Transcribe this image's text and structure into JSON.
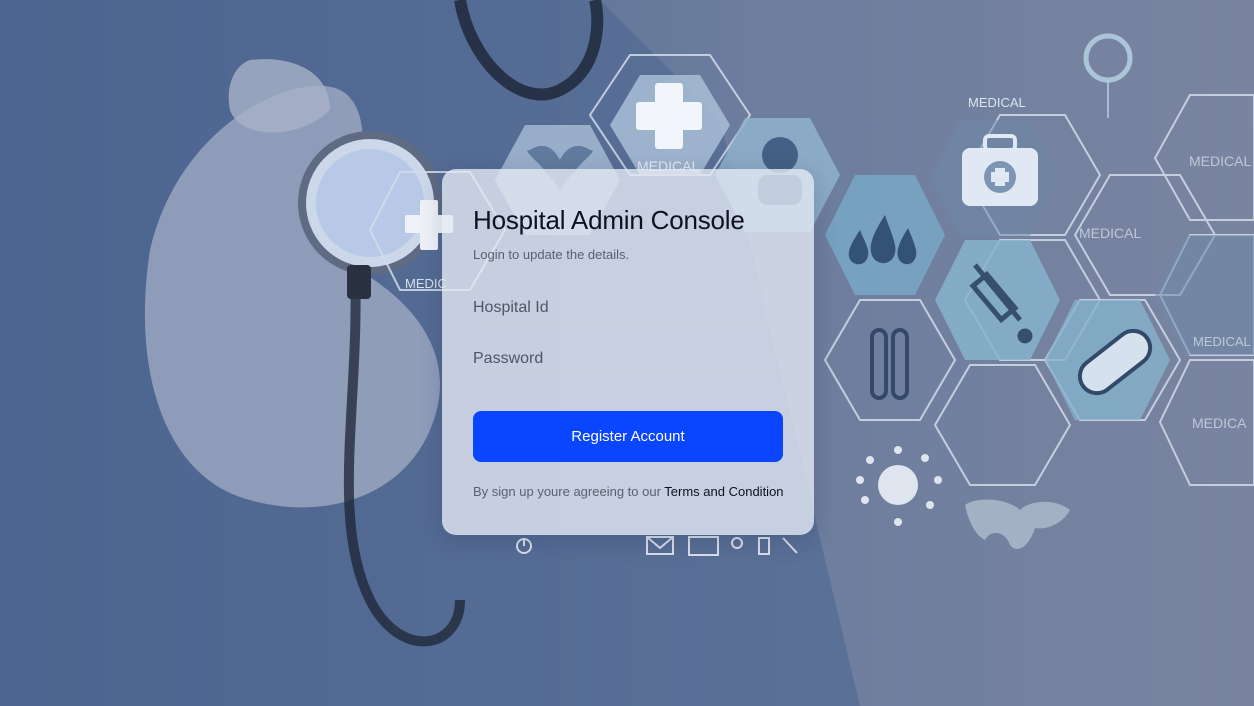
{
  "login": {
    "title": "Hospital Admin Console",
    "subtitle": "Login to update the details.",
    "hospital_id_placeholder": "Hospital Id",
    "password_placeholder": "Password",
    "register_label": "Register Account",
    "terms_prefix": "By sign up youre agreeing to our",
    "terms_link": "Terms and Condition"
  },
  "background": {
    "hex_labels": [
      "MEDICAL",
      "MEDICAL",
      "MEDICAL",
      "MEDICAL",
      "MEDIC",
      "MEDICAL",
      "MEDICA"
    ],
    "icons": [
      "stethoscope-icon",
      "cross-icon",
      "heart-icon",
      "person-icon",
      "first-aid-kit-icon",
      "drops-icon",
      "syringe-icon",
      "test-tubes-icon",
      "pill-icon",
      "virus-icon",
      "world-map-icon",
      "mail-icon",
      "monitor-icon",
      "power-icon"
    ]
  },
  "colors": {
    "accent": "#0a45ff",
    "card": "#e2e8f2",
    "background": "#6c7d9e"
  }
}
